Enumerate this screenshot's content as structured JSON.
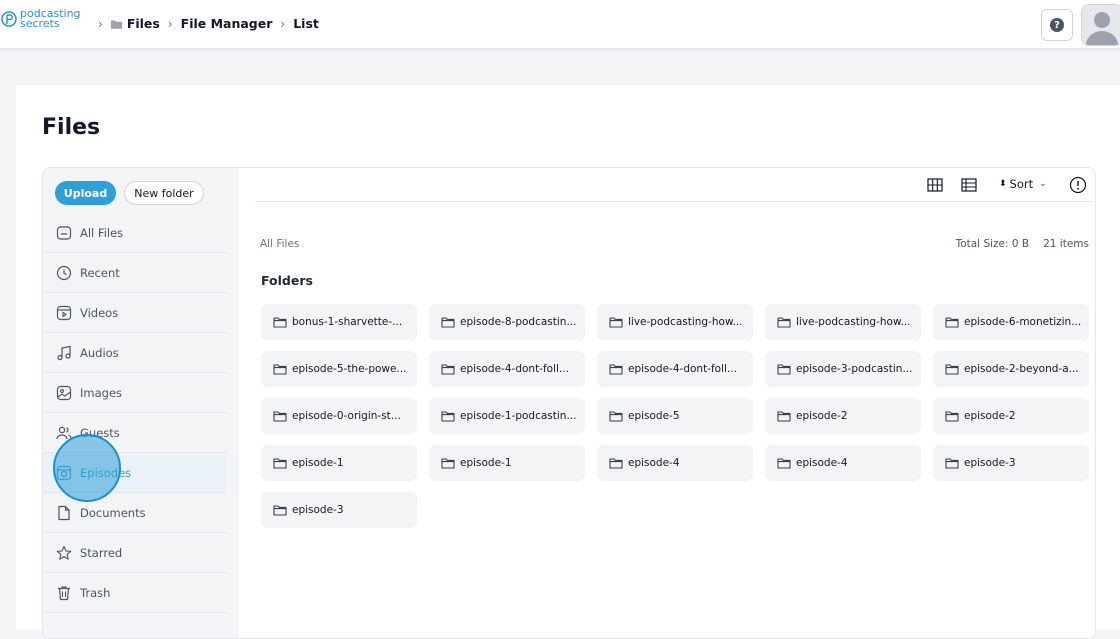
{
  "logo": {
    "line1": "podcasting",
    "line2": "secrets"
  },
  "breadcrumb": [
    "Files",
    "File Manager",
    "List"
  ],
  "page": {
    "title": "Files"
  },
  "actions": {
    "upload": "Upload",
    "new_folder": "New folder"
  },
  "sidebar": {
    "items": [
      {
        "label": "All Files",
        "icon": "all-files-icon"
      },
      {
        "label": "Recent",
        "icon": "clock-icon"
      },
      {
        "label": "Videos",
        "icon": "video-icon"
      },
      {
        "label": "Audios",
        "icon": "music-note-icon"
      },
      {
        "label": "Images",
        "icon": "image-icon"
      },
      {
        "label": "Guests",
        "icon": "users-icon"
      },
      {
        "label": "Episodes",
        "icon": "episode-icon",
        "active": true
      },
      {
        "label": "Documents",
        "icon": "document-icon"
      },
      {
        "label": "Starred",
        "icon": "star-icon"
      },
      {
        "label": "Trash",
        "icon": "trash-icon"
      }
    ]
  },
  "toolbar": {
    "sort_label": "Sort"
  },
  "summary": {
    "path": "All Files",
    "total_size": "Total Size: 0 B",
    "item_count": "21 items"
  },
  "folders": {
    "title": "Folders",
    "items": [
      "bonus-1-sharvette-...",
      "episode-8-podcastin...",
      "live-podcasting-how...",
      "live-podcasting-how...",
      "episode-6-monetizin...",
      "episode-5-the-powe...",
      "episode-4-dont-foll...",
      "episode-4-dont-foll...",
      "episode-3-podcastin...",
      "episode-2-beyond-a...",
      "episode-0-origin-st...",
      "episode-1-podcastin...",
      "episode-5",
      "episode-2",
      "episode-2",
      "episode-1",
      "episode-1",
      "episode-4",
      "episode-4",
      "episode-3",
      "episode-3"
    ]
  },
  "colors": {
    "accent": "#2f9fd8"
  }
}
